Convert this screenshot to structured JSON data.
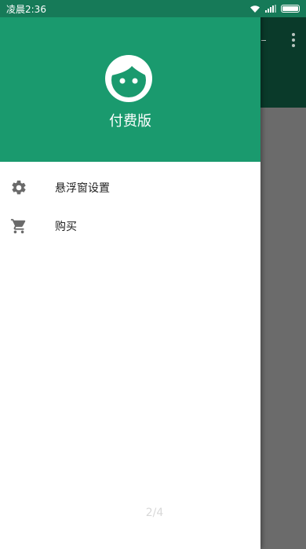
{
  "status_bar": {
    "time": "凌晨2:36"
  },
  "drawer": {
    "header_title": "付费版",
    "avatar_icon": "face-icon",
    "header_color": "#1a9a6e",
    "items": [
      {
        "label": "悬浮窗设置",
        "icon": "gear-icon"
      },
      {
        "label": "购买",
        "icon": "cart-icon"
      }
    ]
  },
  "page_indicator": "2/4"
}
